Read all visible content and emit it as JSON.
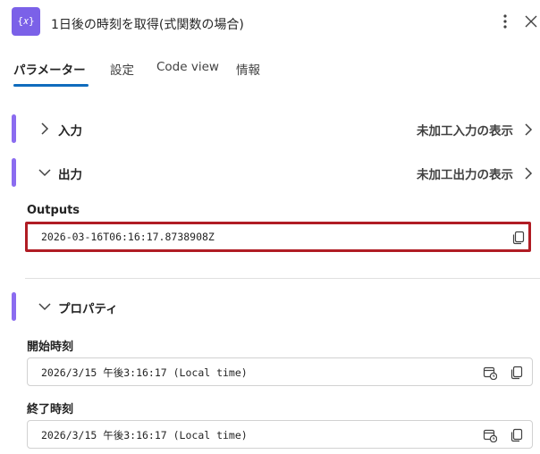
{
  "header": {
    "icon_text": "{𝑥}",
    "title": "1日後の時刻を取得(式関数の場合)"
  },
  "tabs": [
    {
      "label": "パラメーター"
    },
    {
      "label": "設定"
    },
    {
      "label": "Code view"
    },
    {
      "label": "情報"
    }
  ],
  "input_section": {
    "label": "入力",
    "raw_link": "未加工入力の表示"
  },
  "output_section": {
    "label": "出力",
    "raw_link": "未加工出力の表示",
    "outputs_label": "Outputs",
    "outputs_value": "2026-03-16T06:16:17.8738908Z"
  },
  "properties_section": {
    "label": "プロパティ",
    "start_time_label": "開始時刻",
    "start_time_value": "2026/3/15 午後3:16:17 (Local time)",
    "end_time_label": "終了時刻",
    "end_time_value": "2026/3/15 午後3:16:17 (Local time)"
  },
  "colors": {
    "accent": "#8b6cf0",
    "tab_underline": "#0f6cbd",
    "highlight_border": "#b01c24"
  }
}
